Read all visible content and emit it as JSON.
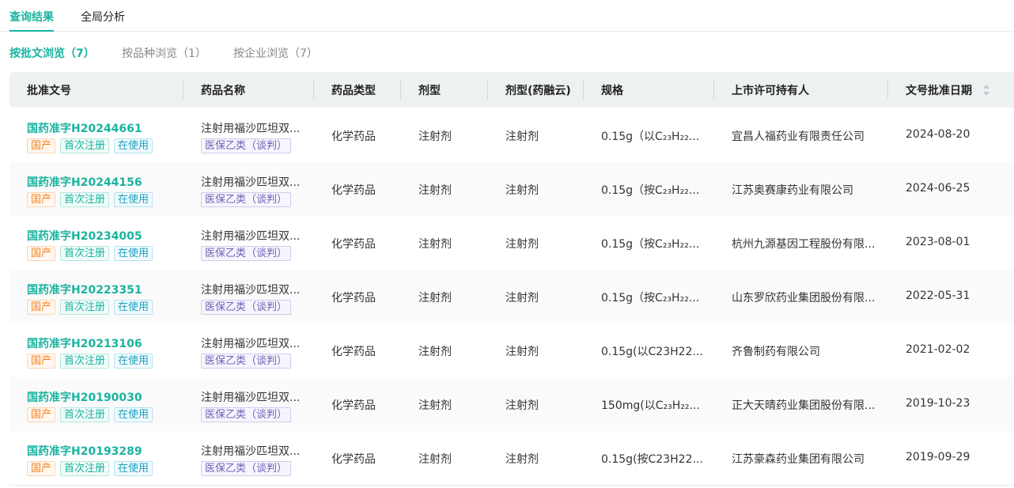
{
  "tabs": [
    "查询结果",
    "全局分析"
  ],
  "subtabs": [
    "按批文浏览（7）",
    "按品种浏览（1）",
    "按企业浏览（7）"
  ],
  "columns": [
    "批准文号",
    "药品名称",
    "药品类型",
    "剂型",
    "剂型(药融云)",
    "规格",
    "上市许可持有人",
    "文号批准日期"
  ],
  "tag_labels": {
    "origin": "国产",
    "reg": "首次注册",
    "status": "在使用",
    "insurance": "医保乙类（谈判）"
  },
  "rows": [
    {
      "code": "国药准字H20244661",
      "name": "注射用福沙匹坦双...",
      "type": "化学药品",
      "form": "注射剂",
      "form2": "注射剂",
      "spec": "0.15g（以C₂₃H₂₂...",
      "holder": "宜昌人福药业有限责任公司",
      "date": "2024-08-20"
    },
    {
      "code": "国药准字H20244156",
      "name": "注射用福沙匹坦双...",
      "type": "化学药品",
      "form": "注射剂",
      "form2": "注射剂",
      "spec": "0.15g（按C₂₃H₂₂...",
      "holder": "江苏奥赛康药业有限公司",
      "date": "2024-06-25"
    },
    {
      "code": "国药准字H20234005",
      "name": "注射用福沙匹坦双...",
      "type": "化学药品",
      "form": "注射剂",
      "form2": "注射剂",
      "spec": "0.15g（按C₂₃H₂₂...",
      "holder": "杭州九源基因工程股份有限...",
      "date": "2023-08-01"
    },
    {
      "code": "国药准字H20223351",
      "name": "注射用福沙匹坦双...",
      "type": "化学药品",
      "form": "注射剂",
      "form2": "注射剂",
      "spec": "0.15g（按C₂₃H₂₂...",
      "holder": "山东罗欣药业集团股份有限...",
      "date": "2022-05-31"
    },
    {
      "code": "国药准字H20213106",
      "name": "注射用福沙匹坦双...",
      "type": "化学药品",
      "form": "注射剂",
      "form2": "注射剂",
      "spec": "0.15g(以C23H22...",
      "holder": "齐鲁制药有限公司",
      "date": "2021-02-02"
    },
    {
      "code": "国药准字H20190030",
      "name": "注射用福沙匹坦双...",
      "type": "化学药品",
      "form": "注射剂",
      "form2": "注射剂",
      "spec": "150mg(以C₂₃H₂₂...",
      "holder": "正大天晴药业集团股份有限...",
      "date": "2019-10-23"
    },
    {
      "code": "国药准字H20193289",
      "name": "注射用福沙匹坦双...",
      "type": "化学药品",
      "form": "注射剂",
      "form2": "注射剂",
      "spec": "0.15g(按C23H22...",
      "holder": "江苏豪森药业集团有限公司",
      "date": "2019-09-29"
    }
  ]
}
